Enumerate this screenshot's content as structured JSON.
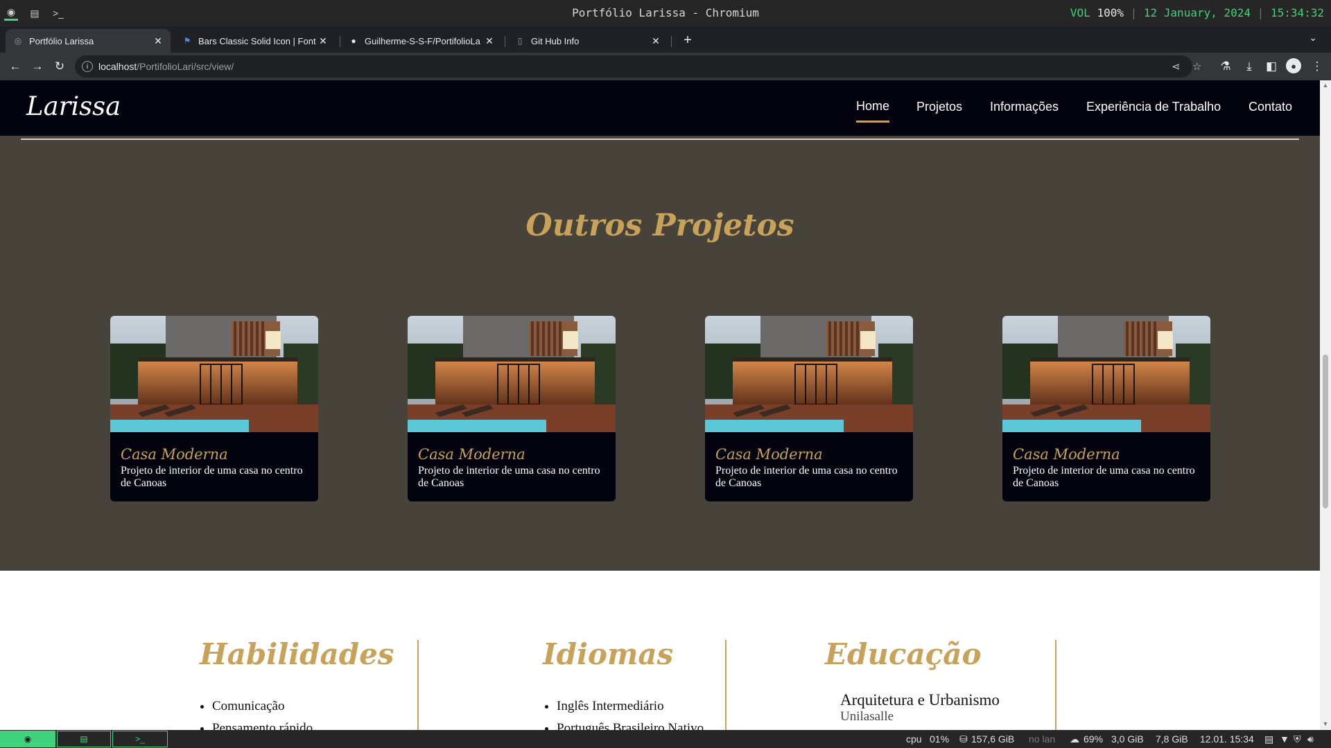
{
  "wm": {
    "title": "Portfólio Larissa - Chromium",
    "vol_label": "VOL",
    "vol_value": "100%",
    "date": "12 January, 2024",
    "time": "15:34:32"
  },
  "tabs": [
    {
      "title": "Portfólio Larissa",
      "icon": "globe-icon",
      "active": true
    },
    {
      "title": "Bars Classic Solid Icon | Font",
      "icon": "flag-icon",
      "active": false
    },
    {
      "title": "Guilherme-S-S-F/PortifolioLa",
      "icon": "github-icon",
      "active": false
    },
    {
      "title": "Git Hub Info",
      "icon": "file-icon",
      "active": false
    }
  ],
  "address": {
    "host": "localhost",
    "path": "/PortifolioLari/src/view/"
  },
  "site": {
    "logo": "Larissa",
    "nav": [
      "Home",
      "Projetos",
      "Informações",
      "Experiência de Trabalho",
      "Contato"
    ],
    "active_nav": "Home"
  },
  "projects": {
    "title": "Outros Projetos",
    "cards": [
      {
        "title": "Casa Moderna",
        "desc": "Projeto de interior de uma casa no centro de Canoas"
      },
      {
        "title": "Casa Moderna",
        "desc": "Projeto de interior de uma casa no centro de Canoas"
      },
      {
        "title": "Casa Moderna",
        "desc": "Projeto de interior de uma casa no centro de Canoas"
      },
      {
        "title": "Casa Moderna",
        "desc": "Projeto de interior de uma casa no centro de Canoas"
      }
    ]
  },
  "info": {
    "skills_title": "Habilidades",
    "skills": [
      "Comunicação",
      "Pensamento rápido"
    ],
    "languages_title": "Idiomas",
    "languages": [
      "Inglês Intermediário",
      "Português Brasileiro Nativo"
    ],
    "education_title": "Educação",
    "degree": "Arquitetura e Urbanismo",
    "school": "Unilasalle"
  },
  "panel": {
    "cpu_label": "cpu",
    "cpu": "01%",
    "disk": "157,6 GiB",
    "lan": "no lan",
    "battery": "69%",
    "mem_used": "3,0 GiB",
    "mem_total": "7,8 GiB",
    "clock": "12.01. 15:34"
  },
  "colors": {
    "accent_gold": "#c9a25a",
    "nav_bg": "#02030f",
    "section_bg": "#47423a",
    "wm_green": "#3fd47b"
  }
}
